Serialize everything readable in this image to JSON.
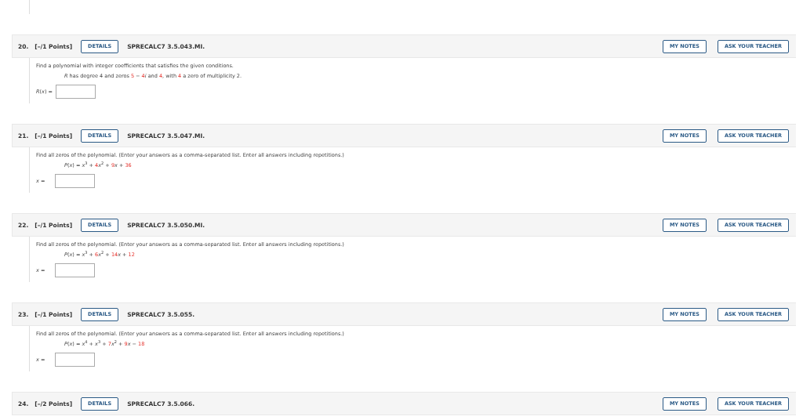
{
  "questions": [
    {
      "number": "20.",
      "points": "[–/1 Points]",
      "details": "DETAILS",
      "code": "SPRECALC7 3.5.043.MI.",
      "notes": "MY NOTES",
      "ask": "ASK YOUR TEACHER",
      "instruction": "Find a polynomial with integer coefficients that satisfies the given conditions.",
      "condition": [
        {
          "text": "*R* has degree 4 and zeros ",
          "red": false
        },
        {
          "text": "5",
          "red": true
        },
        {
          "text": " − ",
          "red": false
        },
        {
          "text": "4",
          "red": true
        },
        {
          "text": "*i* and ",
          "red": false
        },
        {
          "text": "4",
          "red": true
        },
        {
          "text": ", with ",
          "red": false
        },
        {
          "text": "4",
          "red": true
        },
        {
          "text": " a zero of multiplicity 2.",
          "red": false
        }
      ],
      "answer_label": "*R*(*x*) ="
    },
    {
      "number": "21.",
      "points": "[–/1 Points]",
      "details": "DETAILS",
      "code": "SPRECALC7 3.5.047.MI.",
      "notes": "MY NOTES",
      "ask": "ASK YOUR TEACHER",
      "instruction": "Find all zeros of the polynomial. (Enter your answers as a comma-separated list. Enter all answers including repetitions.)",
      "condition": [
        {
          "text": "*P*(*x*) = *x*$^{3}$ + ",
          "red": false
        },
        {
          "text": "4",
          "red": true
        },
        {
          "text": "*x*$^{2}$ + ",
          "red": false
        },
        {
          "text": "9",
          "red": true
        },
        {
          "text": "*x* + ",
          "red": false
        },
        {
          "text": "36",
          "red": true
        }
      ],
      "answer_label": "*x* ="
    },
    {
      "number": "22.",
      "points": "[–/1 Points]",
      "details": "DETAILS",
      "code": "SPRECALC7 3.5.050.MI.",
      "notes": "MY NOTES",
      "ask": "ASK YOUR TEACHER",
      "instruction": "Find all zeros of the polynomial. (Enter your answers as a comma-separated list. Enter all answers including repetitions.)",
      "condition": [
        {
          "text": "*P*(*x*) = *x*$^{3}$ + ",
          "red": false
        },
        {
          "text": "6",
          "red": true
        },
        {
          "text": "*x*$^{2}$ + ",
          "red": false
        },
        {
          "text": "14",
          "red": true
        },
        {
          "text": "*x* + ",
          "red": false
        },
        {
          "text": "12",
          "red": true
        }
      ],
      "answer_label": "*x* ="
    },
    {
      "number": "23.",
      "points": "[–/1 Points]",
      "details": "DETAILS",
      "code": "SPRECALC7 3.5.055.",
      "notes": "MY NOTES",
      "ask": "ASK YOUR TEACHER",
      "instruction": "Find all zeros of the polynomial. (Enter your answers as a comma-separated list. Enter all answers including repetitions.)",
      "condition": [
        {
          "text": "*P*(*x*) = *x*$^{4}$ + *x*$^{3}$ + ",
          "red": false
        },
        {
          "text": "7",
          "red": true
        },
        {
          "text": "*x*$^{2}$ + ",
          "red": false
        },
        {
          "text": "9",
          "red": true
        },
        {
          "text": "*x* − ",
          "red": false
        },
        {
          "text": "18",
          "red": true
        }
      ],
      "answer_label": "*x* ="
    },
    {
      "number": "24.",
      "points": "[–/2 Points]",
      "details": "DETAILS",
      "code": "SPRECALC7 3.5.066.",
      "notes": "MY NOTES",
      "ask": "ASK YOUR TEACHER"
    }
  ]
}
